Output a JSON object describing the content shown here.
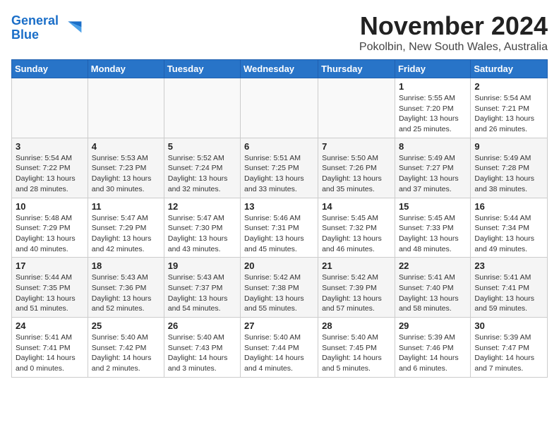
{
  "logo": {
    "line1": "General",
    "line2": "Blue"
  },
  "title": "November 2024",
  "location": "Pokolbin, New South Wales, Australia",
  "weekdays": [
    "Sunday",
    "Monday",
    "Tuesday",
    "Wednesday",
    "Thursday",
    "Friday",
    "Saturday"
  ],
  "weeks": [
    [
      {
        "day": "",
        "info": ""
      },
      {
        "day": "",
        "info": ""
      },
      {
        "day": "",
        "info": ""
      },
      {
        "day": "",
        "info": ""
      },
      {
        "day": "",
        "info": ""
      },
      {
        "day": "1",
        "info": "Sunrise: 5:55 AM\nSunset: 7:20 PM\nDaylight: 13 hours\nand 25 minutes."
      },
      {
        "day": "2",
        "info": "Sunrise: 5:54 AM\nSunset: 7:21 PM\nDaylight: 13 hours\nand 26 minutes."
      }
    ],
    [
      {
        "day": "3",
        "info": "Sunrise: 5:54 AM\nSunset: 7:22 PM\nDaylight: 13 hours\nand 28 minutes."
      },
      {
        "day": "4",
        "info": "Sunrise: 5:53 AM\nSunset: 7:23 PM\nDaylight: 13 hours\nand 30 minutes."
      },
      {
        "day": "5",
        "info": "Sunrise: 5:52 AM\nSunset: 7:24 PM\nDaylight: 13 hours\nand 32 minutes."
      },
      {
        "day": "6",
        "info": "Sunrise: 5:51 AM\nSunset: 7:25 PM\nDaylight: 13 hours\nand 33 minutes."
      },
      {
        "day": "7",
        "info": "Sunrise: 5:50 AM\nSunset: 7:26 PM\nDaylight: 13 hours\nand 35 minutes."
      },
      {
        "day": "8",
        "info": "Sunrise: 5:49 AM\nSunset: 7:27 PM\nDaylight: 13 hours\nand 37 minutes."
      },
      {
        "day": "9",
        "info": "Sunrise: 5:49 AM\nSunset: 7:28 PM\nDaylight: 13 hours\nand 38 minutes."
      }
    ],
    [
      {
        "day": "10",
        "info": "Sunrise: 5:48 AM\nSunset: 7:29 PM\nDaylight: 13 hours\nand 40 minutes."
      },
      {
        "day": "11",
        "info": "Sunrise: 5:47 AM\nSunset: 7:29 PM\nDaylight: 13 hours\nand 42 minutes."
      },
      {
        "day": "12",
        "info": "Sunrise: 5:47 AM\nSunset: 7:30 PM\nDaylight: 13 hours\nand 43 minutes."
      },
      {
        "day": "13",
        "info": "Sunrise: 5:46 AM\nSunset: 7:31 PM\nDaylight: 13 hours\nand 45 minutes."
      },
      {
        "day": "14",
        "info": "Sunrise: 5:45 AM\nSunset: 7:32 PM\nDaylight: 13 hours\nand 46 minutes."
      },
      {
        "day": "15",
        "info": "Sunrise: 5:45 AM\nSunset: 7:33 PM\nDaylight: 13 hours\nand 48 minutes."
      },
      {
        "day": "16",
        "info": "Sunrise: 5:44 AM\nSunset: 7:34 PM\nDaylight: 13 hours\nand 49 minutes."
      }
    ],
    [
      {
        "day": "17",
        "info": "Sunrise: 5:44 AM\nSunset: 7:35 PM\nDaylight: 13 hours\nand 51 minutes."
      },
      {
        "day": "18",
        "info": "Sunrise: 5:43 AM\nSunset: 7:36 PM\nDaylight: 13 hours\nand 52 minutes."
      },
      {
        "day": "19",
        "info": "Sunrise: 5:43 AM\nSunset: 7:37 PM\nDaylight: 13 hours\nand 54 minutes."
      },
      {
        "day": "20",
        "info": "Sunrise: 5:42 AM\nSunset: 7:38 PM\nDaylight: 13 hours\nand 55 minutes."
      },
      {
        "day": "21",
        "info": "Sunrise: 5:42 AM\nSunset: 7:39 PM\nDaylight: 13 hours\nand 57 minutes."
      },
      {
        "day": "22",
        "info": "Sunrise: 5:41 AM\nSunset: 7:40 PM\nDaylight: 13 hours\nand 58 minutes."
      },
      {
        "day": "23",
        "info": "Sunrise: 5:41 AM\nSunset: 7:41 PM\nDaylight: 13 hours\nand 59 minutes."
      }
    ],
    [
      {
        "day": "24",
        "info": "Sunrise: 5:41 AM\nSunset: 7:41 PM\nDaylight: 14 hours\nand 0 minutes."
      },
      {
        "day": "25",
        "info": "Sunrise: 5:40 AM\nSunset: 7:42 PM\nDaylight: 14 hours\nand 2 minutes."
      },
      {
        "day": "26",
        "info": "Sunrise: 5:40 AM\nSunset: 7:43 PM\nDaylight: 14 hours\nand 3 minutes."
      },
      {
        "day": "27",
        "info": "Sunrise: 5:40 AM\nSunset: 7:44 PM\nDaylight: 14 hours\nand 4 minutes."
      },
      {
        "day": "28",
        "info": "Sunrise: 5:40 AM\nSunset: 7:45 PM\nDaylight: 14 hours\nand 5 minutes."
      },
      {
        "day": "29",
        "info": "Sunrise: 5:39 AM\nSunset: 7:46 PM\nDaylight: 14 hours\nand 6 minutes."
      },
      {
        "day": "30",
        "info": "Sunrise: 5:39 AM\nSunset: 7:47 PM\nDaylight: 14 hours\nand 7 minutes."
      }
    ]
  ]
}
